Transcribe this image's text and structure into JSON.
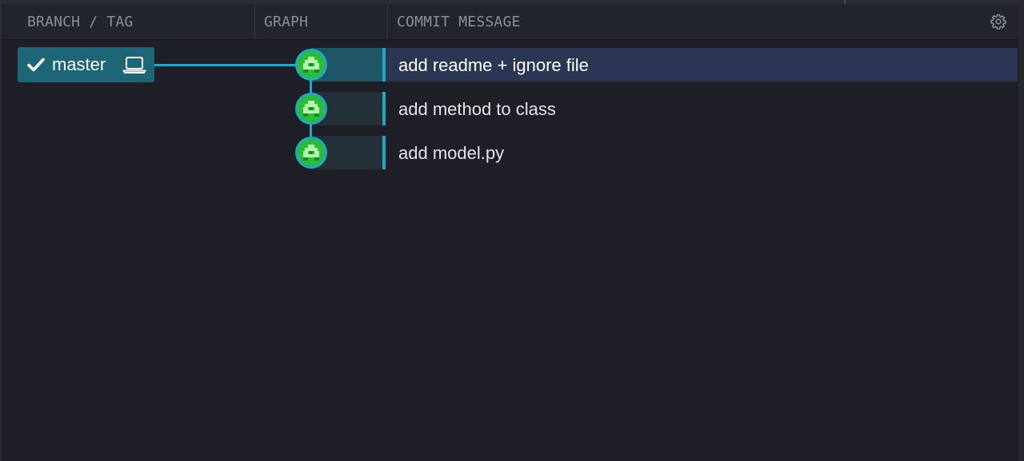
{
  "header": {
    "branch_tag": "BRANCH / TAG",
    "graph": "GRAPH",
    "commit_message": "COMMIT MESSAGE"
  },
  "branch": {
    "name": "master",
    "checked_out": true,
    "icons": [
      "check-icon",
      "laptop-icon"
    ]
  },
  "commits": [
    {
      "message": "add readme + ignore file",
      "selected": true
    },
    {
      "message": "add method to class",
      "selected": false
    },
    {
      "message": "add model.py",
      "selected": false
    }
  ],
  "colors": {
    "accent": "#22a7c4",
    "branch_bg": "#1d6677",
    "selected_row": "#2a3654",
    "avatar": "#2bbd3a",
    "background": "#1f2027"
  }
}
